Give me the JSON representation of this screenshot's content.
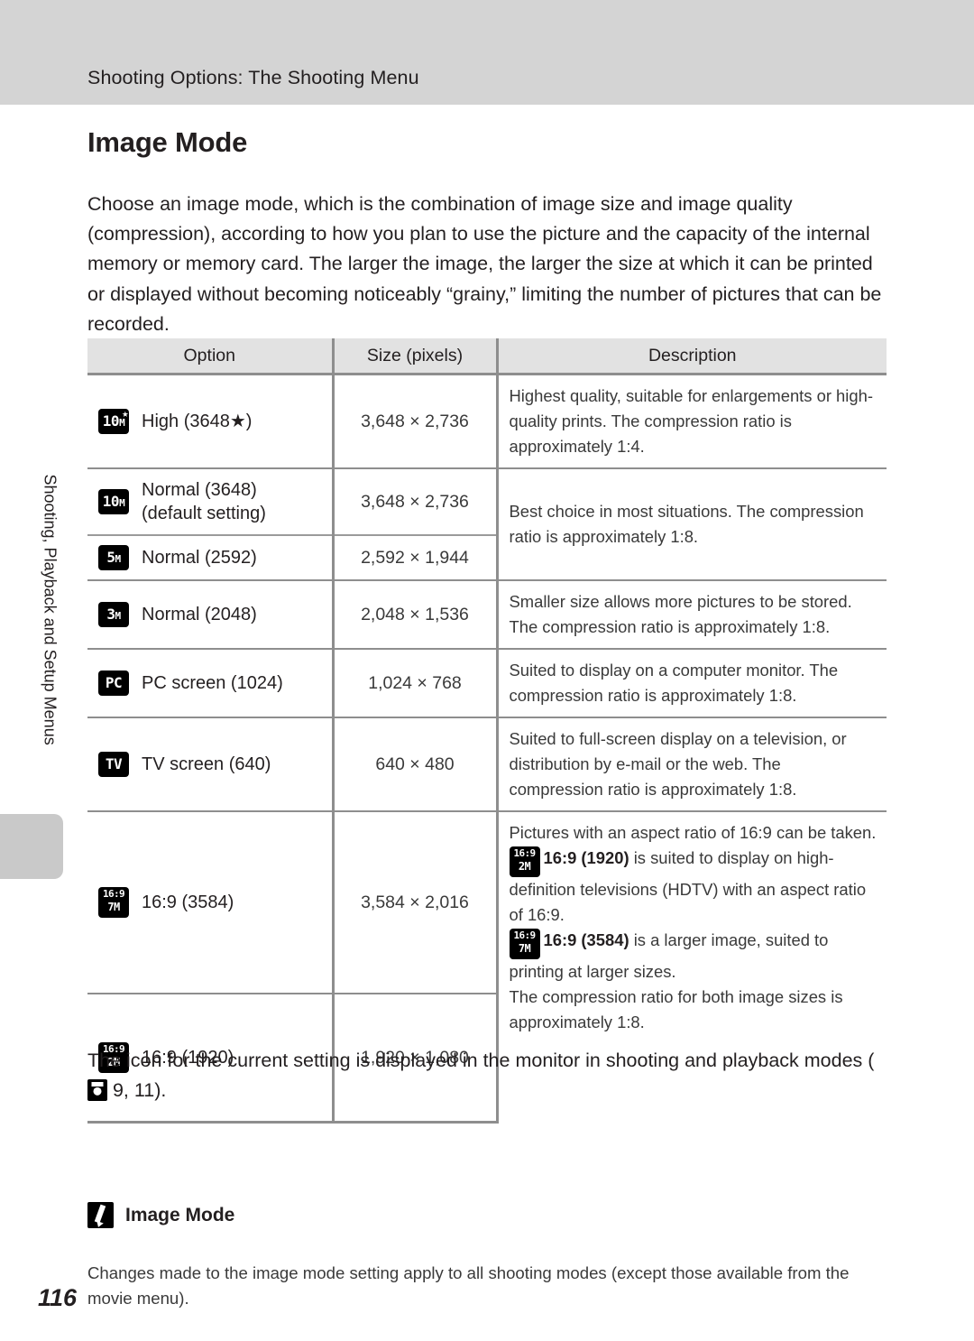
{
  "header": {
    "running_title": "Shooting Options: The Shooting Menu"
  },
  "sidebar": {
    "tab_label": "Shooting, Playback and Setup Menus"
  },
  "page": {
    "number": "116",
    "section_title": "Image Mode",
    "intro": "Choose an image mode, which is the combination of image size and image quality (compression), according to how you plan to use the picture and the capacity of the internal memory or memory card. The larger the image, the larger the size at which it can be printed or displayed without becoming noticeably “grainy,” limiting the number of pictures that can be recorded.",
    "after_table_text_1": "The icon for the current setting is displayed in the monitor in shooting and",
    "after_table_text_2": "playback modes (",
    "after_table_text_3": " 9, 11)."
  },
  "table": {
    "headers": {
      "option": "Option",
      "size": "Size (pixels)",
      "description": "Description"
    },
    "rows": [
      {
        "icon_main": "10",
        "icon_sub": "M",
        "icon_star": "★",
        "option": "High (3648★)",
        "size": "3,648 × 2,736",
        "description": "Highest quality, suitable for enlargements or high-quality prints. The compression ratio is approximately 1:4."
      },
      {
        "icon_main": "10",
        "icon_sub": "M",
        "option_line1": "Normal (3648)",
        "option_line2": "(default setting)",
        "size": "3,648 × 2,736",
        "description": "Best choice in most situations. The compression ratio is approximately 1:8."
      },
      {
        "icon_main": "5",
        "icon_sub": "M",
        "option": "Normal (2592)",
        "size": "2,592 × 1,944"
      },
      {
        "icon_main": "3",
        "icon_sub": "M",
        "option": "Normal (2048)",
        "size": "2,048 × 1,536",
        "description": "Smaller size allows more pictures to be stored. The compression ratio is approximately 1:8."
      },
      {
        "icon_main": "PC",
        "option": "PC screen (1024)",
        "size": "1,024 × 768",
        "description": "Suited to display on a computer monitor. The compression ratio is approximately 1:8."
      },
      {
        "icon_main": "TV",
        "option": "TV screen (640)",
        "size": "640 × 480",
        "description": "Suited to full-screen display on a television, or distribution by e-mail or the web. The compression ratio is approximately 1:8."
      },
      {
        "icon_line1": "16:9",
        "icon_line2": "7M",
        "option": "16:9 (3584)",
        "size": "3,584 × 2,016"
      },
      {
        "icon_line1": "16:9",
        "icon_line2": "2M",
        "option": "16:9 (1920)",
        "size": "1,920 × 1,080"
      }
    ],
    "wide_description": {
      "p1": "Pictures with an aspect ratio of 16:9 can be taken.",
      "icon_a_l1": "16:9",
      "icon_a_l2": "2M",
      "bold_a": "16:9 (1920)",
      "p2": " is suited to display on high-definition televisions (HDTV) with an aspect ratio of 16:9.",
      "icon_b_l1": "16:9",
      "icon_b_l2": "7M",
      "bold_b": "16:9 (3584)",
      "p3": " is a larger image, suited to printing at larger sizes.",
      "p4": "The compression ratio for both image sizes is approximately 1:8."
    }
  },
  "note": {
    "title": "Image Mode",
    "body": "Changes made to the image mode setting apply to all shooting modes (except those available from the movie menu)."
  },
  "colors": {
    "header_band": "#d4d4d4",
    "table_header_bg": "#e2e2e2",
    "rule": "#8e8e8e",
    "text": "#231f20"
  }
}
